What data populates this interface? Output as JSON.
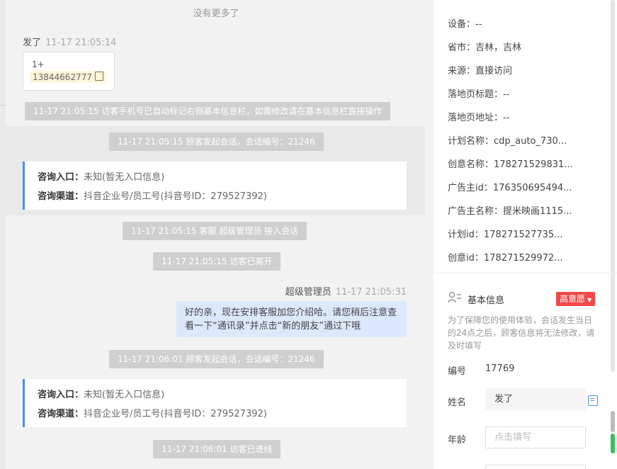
{
  "chat": {
    "no_more": "没有更多了",
    "visitor_msg": {
      "name": "发了",
      "time": "11-17 21:05:14",
      "line1": "1+",
      "phone": "13844662777"
    },
    "system": [
      "11-17 21:05:15 访客手机号已自动标记右侧基本信息栏，如需修改请在基本信息栏直接操作",
      "11-17 21:05:15 顾客发起会话，会话编号：21246",
      "11-17 21:05:15 客服 超级管理员 接入会话",
      "11-17 21:05:15 访客已离开",
      "11-17 21:06:01 顾客发起会话，会话编号：21246",
      "11-17 21:06:01 访客已进线"
    ],
    "info_cards": [
      {
        "entry_label": "咨询入口：",
        "entry_value": "未知(暂无入口信息)",
        "channel_label": "咨询渠道：",
        "channel_value": "抖音企业号/员工号(抖音号ID：279527392)"
      },
      {
        "entry_label": "咨询入口：",
        "entry_value": "未知(暂无入口信息)",
        "channel_label": "咨询渠道：",
        "channel_value": "抖音企业号/员工号(抖音号ID：279527392)"
      }
    ],
    "agent_msg": {
      "name": "超级管理员",
      "time": "11-17 21:05:31",
      "line1": "好的亲，现在安排客服加您介绍哈。请您稍后注意查",
      "line2": "看一下“通讯录”并点击“新的朋友”通过下哦"
    }
  },
  "panel": {
    "details": [
      {
        "label": "设备：",
        "value": "--"
      },
      {
        "label": "省市：",
        "value": "吉林，吉林"
      },
      {
        "label": "来源：",
        "value": "直接访问"
      },
      {
        "label": "落地页标题：",
        "value": "--"
      },
      {
        "label": "落地页地址：",
        "value": "--"
      },
      {
        "label": "计划名称：",
        "value": "cdp_auto_730..."
      },
      {
        "label": "创意名称：",
        "value": "178271529831..."
      },
      {
        "label": "广告主id：",
        "value": "176350695494..."
      },
      {
        "label": "广告主名称：",
        "value": "提米映画1115..."
      },
      {
        "label": "计划id：",
        "value": "178271527735..."
      },
      {
        "label": "创意id：",
        "value": "178271529972..."
      }
    ],
    "basic_title": "基本信息",
    "intent_badge": "高意愿",
    "note": "为了保障您的使用体验，会话发生当日的24点之后，顾客信息将无法修改，请及时填写",
    "id_label": "编号",
    "id_value": "17769",
    "name_label": "姓名",
    "name_value": "发了",
    "age_label": "年龄",
    "age_placeholder": "点击填写"
  }
}
